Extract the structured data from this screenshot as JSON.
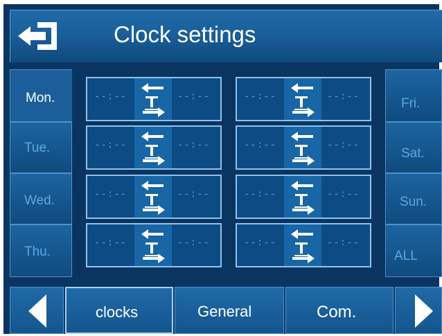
{
  "header": {
    "title": "Clock settings",
    "back_icon": "exit-arrow-icon"
  },
  "days_left": [
    {
      "label": "Mon.",
      "active": true
    },
    {
      "label": "Tue.",
      "active": false
    },
    {
      "label": "Wed.",
      "active": false
    },
    {
      "label": "Thu.",
      "active": false
    }
  ],
  "days_right": [
    {
      "label": "Fri."
    },
    {
      "label": "Sat."
    },
    {
      "label": "Sun."
    },
    {
      "label": "ALL"
    }
  ],
  "slots": [
    {
      "start": "--:--",
      "end": "--:--"
    },
    {
      "start": "--:--",
      "end": "--:--"
    },
    {
      "start": "--:--",
      "end": "--:--"
    },
    {
      "start": "--:--",
      "end": "--:--"
    },
    {
      "start": "--:--",
      "end": "--:--"
    },
    {
      "start": "--:--",
      "end": "--:--"
    },
    {
      "start": "--:--",
      "end": "--:--"
    },
    {
      "start": "--:--",
      "end": "--:--"
    }
  ],
  "slot_icon": "temperature-switch-icon",
  "bottom_nav": {
    "prev_icon": "triangle-left-icon",
    "next_icon": "triangle-right-icon",
    "tabs": [
      {
        "label": "clocks",
        "active": true
      },
      {
        "label": "General",
        "active": false
      },
      {
        "label": "Com.",
        "active": false
      }
    ]
  },
  "colors": {
    "background": "#0b3561",
    "panel": "#1a5f9a",
    "inactive_text": "#5ea6e0",
    "active_text": "#ffffff"
  }
}
